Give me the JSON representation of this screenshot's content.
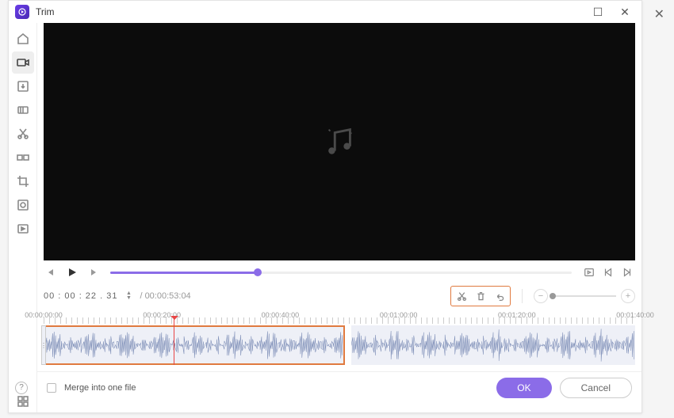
{
  "title": "Trim",
  "timecode": "00 : 00 : 22 . 31",
  "duration": "/ 00:00:53:04",
  "ruler_ticks": [
    {
      "label": "00:00:00:00",
      "pct": 0
    },
    {
      "label": "00:00:20:00",
      "pct": 20
    },
    {
      "label": "00:00:40:00",
      "pct": 40
    },
    {
      "label": "00:01:00:00",
      "pct": 60
    },
    {
      "label": "00:01:20:00",
      "pct": 80
    },
    {
      "label": "00:01:40:00",
      "pct": 100
    }
  ],
  "clips": [
    {
      "start_pct": 0,
      "end_pct": 51,
      "selected": true
    },
    {
      "start_pct": 52,
      "end_pct": 100,
      "selected": false
    }
  ],
  "playhead_pct": 22,
  "progress_pct": 32,
  "merge_label": "Merge into one file",
  "ok_label": "OK",
  "cancel_label": "Cancel"
}
